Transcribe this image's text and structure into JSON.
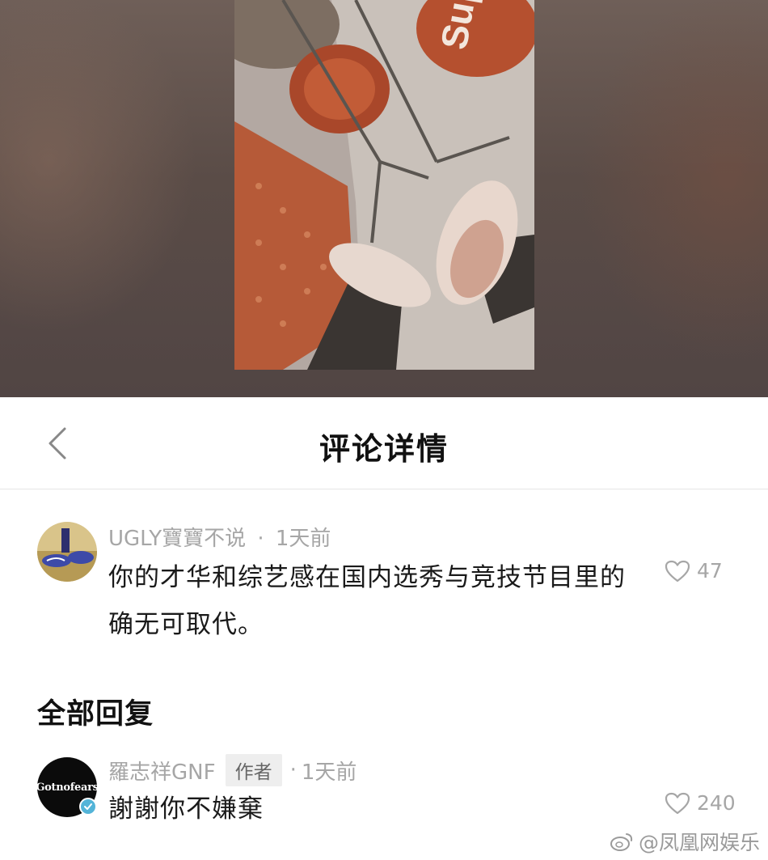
{
  "header": {
    "title": "评论详情",
    "back_icon": "chevron-left-icon"
  },
  "comment": {
    "username": "UGLY寶寶不说",
    "separator": "·",
    "time": "1天前",
    "text": "你的才华和综艺感在国内选秀与竞技节目里的确无可取代。",
    "likes": "47",
    "like_icon": "heart-outline-icon"
  },
  "replies": {
    "section_title": "全部回复",
    "items": [
      {
        "username": "羅志祥GNF",
        "badge": "作者",
        "separator": "·",
        "time": "1天前",
        "text": "謝謝你不嫌棄",
        "likes": "240",
        "avatar_text": "Gotnofears",
        "verified": true
      }
    ]
  },
  "hero_photo": {
    "drum_text": "Supreme"
  },
  "watermark": {
    "text": "@凤凰网娱乐",
    "icon": "weibo-icon"
  },
  "colors": {
    "meta_gray": "#a6a6a6",
    "verified_blue": "#53b4d8",
    "drum_red": "#b5502f"
  }
}
